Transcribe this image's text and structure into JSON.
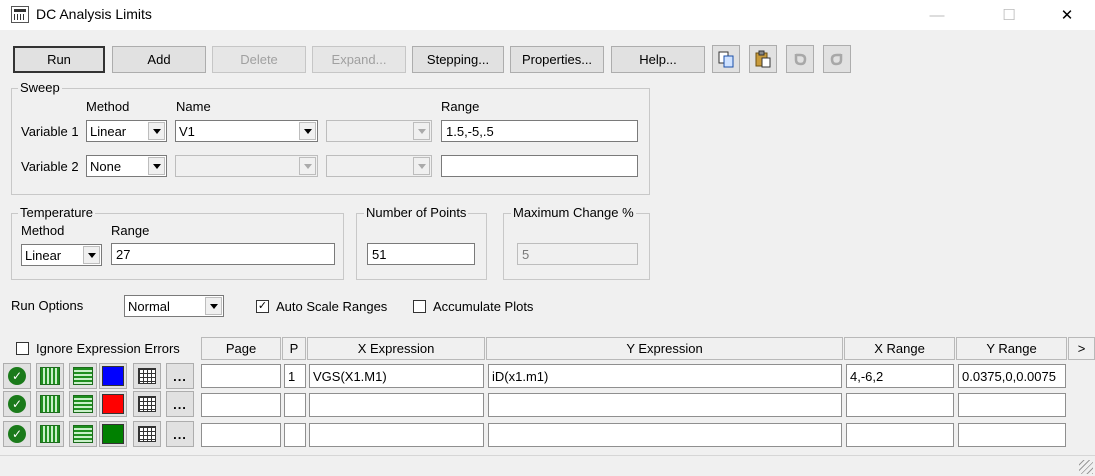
{
  "window": {
    "title": "DC Analysis Limits",
    "min_glyph": "—",
    "max_glyph": "☐",
    "close_glyph": "✕"
  },
  "toolbar": {
    "run": "Run",
    "add": "Add",
    "delete": "Delete",
    "expand": "Expand...",
    "stepping": "Stepping...",
    "properties": "Properties...",
    "help": "Help...",
    "icons": [
      "copy-icon",
      "paste-icon",
      "undo-icon",
      "redo-icon"
    ]
  },
  "sweep": {
    "group_label": "Sweep",
    "method_header": "Method",
    "name_header": "Name",
    "range_header": "Range",
    "variable1": {
      "label": "Variable 1",
      "method": "Linear",
      "name": "V1",
      "name2": "",
      "range": "1.5,-5,.5"
    },
    "variable2": {
      "label": "Variable 2",
      "method": "None",
      "name": "",
      "name2": "",
      "range": ""
    }
  },
  "temperature": {
    "group_label": "Temperature",
    "method_header": "Method",
    "range_header": "Range",
    "method": "Linear",
    "range": "27"
  },
  "points": {
    "group_label": "Number of Points",
    "value": "51"
  },
  "max_change": {
    "group_label": "Maximum Change %",
    "value": "5"
  },
  "run_options": {
    "label": "Run Options",
    "value": "Normal",
    "auto_scale_label": "Auto Scale Ranges",
    "auto_scale_checked": true,
    "accumulate_label": "Accumulate Plots",
    "accumulate_checked": false
  },
  "grid": {
    "ignore_label": "Ignore Expression Errors",
    "ignore_checked": false,
    "columns": {
      "page": "Page",
      "p": "P",
      "x_expression": "X Expression",
      "y_expression": "Y Expression",
      "x_range": "X Range",
      "y_range": "Y Range",
      "more": ">"
    },
    "more_glyph": "...",
    "rows": [
      {
        "color": "#0000ff",
        "page": "",
        "p": "1",
        "x_expr": "VGS(X1.M1)",
        "y_expr": "iD(x1.m1)",
        "x_range": "4,-6,2",
        "y_range": "0.0375,0,0.0075"
      },
      {
        "color": "#ff0000",
        "page": "",
        "p": "",
        "x_expr": "",
        "y_expr": "",
        "x_range": "",
        "y_range": ""
      },
      {
        "color": "#008000",
        "page": "",
        "p": "",
        "x_expr": "",
        "y_expr": "",
        "x_range": "",
        "y_range": ""
      }
    ]
  }
}
